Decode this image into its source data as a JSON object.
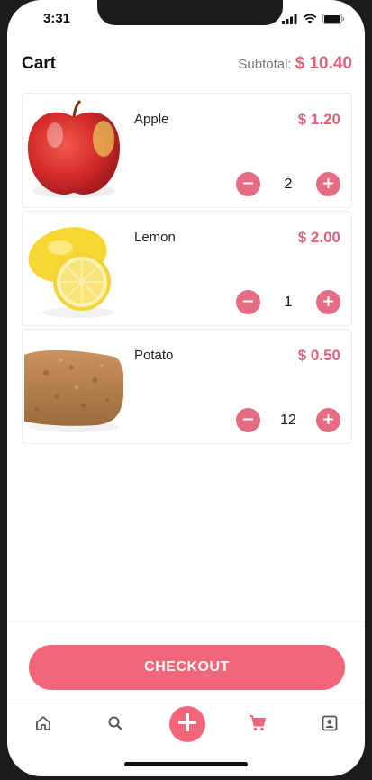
{
  "status": {
    "time": "3:31"
  },
  "header": {
    "title": "Cart",
    "subtotal_label": "Subtotal:",
    "subtotal_value": "$ 10.40"
  },
  "items": [
    {
      "name": "Apple",
      "price": "$ 1.20",
      "quantity": "2",
      "image": "apple"
    },
    {
      "name": "Lemon",
      "price": "$ 2.00",
      "quantity": "1",
      "image": "lemon"
    },
    {
      "name": "Potato",
      "price": "$ 0.50",
      "quantity": "12",
      "image": "potato"
    }
  ],
  "checkout": {
    "label": "CHECKOUT"
  },
  "tabbar": {
    "tabs": [
      {
        "icon": "home-icon",
        "active": false
      },
      {
        "icon": "search-icon",
        "active": false
      },
      {
        "icon": "add-icon",
        "active": false
      },
      {
        "icon": "cart-icon",
        "active": true
      },
      {
        "icon": "profile-icon",
        "active": false
      }
    ]
  },
  "colors": {
    "accent": "#f2667a",
    "price": "#e0637a",
    "inactive_icon": "#555555"
  }
}
